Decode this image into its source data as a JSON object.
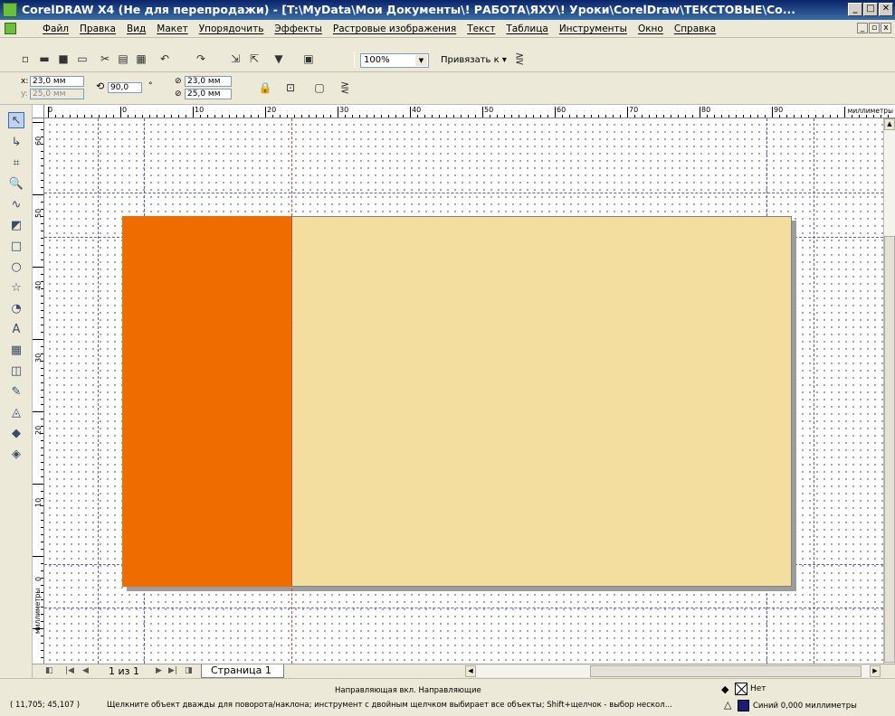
{
  "window": {
    "title": "CorelDRAW X4 (Не для перепродажи) - [T:\\MyData\\Мои Документы\\! РАБОТА\\ЯХУ\\! Уроки\\CorelDraw\\ТЕКСТОВЫЕ\\Co...",
    "min_glyph": "_",
    "max_glyph": "□",
    "close_glyph": "✕"
  },
  "menu": {
    "items": [
      "Файл",
      "Правка",
      "Вид",
      "Макет",
      "Упорядочить",
      "Эффекты",
      "Растровые изображения",
      "Текст",
      "Таблица",
      "Инструменты",
      "Окно",
      "Справка"
    ],
    "mdi_min": "_",
    "mdi_restore": "▫",
    "mdi_close": "x"
  },
  "toolbar": {
    "zoom_value": "100%",
    "snap_label": "Привязать к"
  },
  "property_bar": {
    "x_label": "x:",
    "x_value": "23,0 мм",
    "y_label": "y:",
    "y_value": "25,0 мм",
    "rotation_value": "90,0",
    "degree_symbol": "°",
    "pos1_value": "23,0 мм",
    "pos2_value": "25,0 мм"
  },
  "ruler": {
    "h_labels": [
      "0",
      "0",
      "10",
      "20",
      "30",
      "40",
      "50",
      "60",
      "70",
      "80",
      "90"
    ],
    "h_unit": "миллиметры",
    "v_labels": [
      "60",
      "50",
      "40",
      "30",
      "20",
      "10",
      "0"
    ],
    "v_unit": "миллиметры"
  },
  "pages": {
    "count_text": "1 из 1",
    "tab_label": "Страница 1"
  },
  "status": {
    "guide_text": "Направляющая вкл. Направляющие",
    "coords": "( 11,705; 45,107 )",
    "hint": "Щелкните объект дважды для поворота/наклона; инструмент с двойным щелчком выбирает все объекты; Shift+щелчок - выбор нескол...",
    "fill_text": "Нет",
    "outline_text": "Синий  0,000 миллиметры"
  },
  "colors": {
    "orange_rect": "#ef6c00",
    "beige_rect": "#f3de9f",
    "outline_swatch": "#1f1a7a"
  }
}
